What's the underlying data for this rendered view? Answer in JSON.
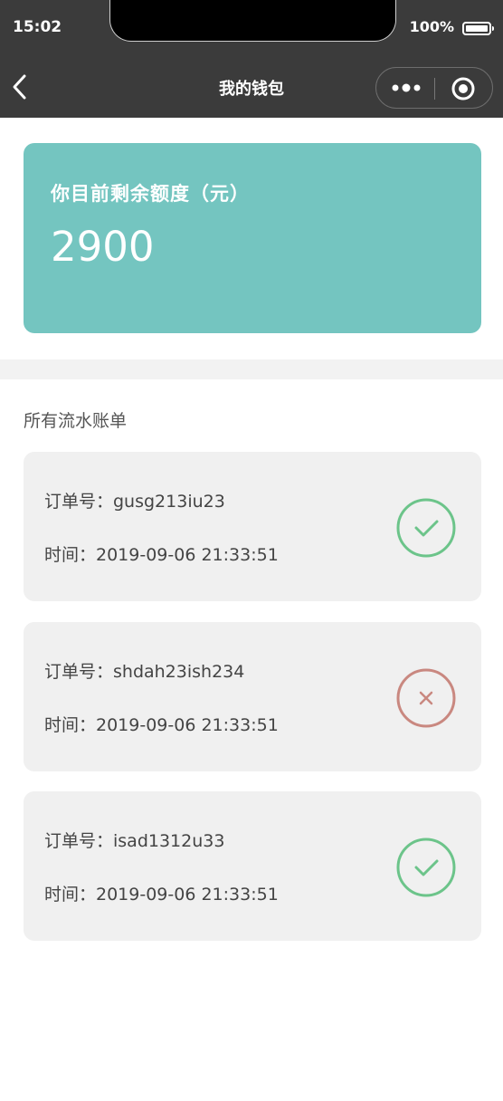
{
  "status_bar": {
    "time": "15:02",
    "battery": "100%"
  },
  "nav": {
    "title": "我的钱包"
  },
  "balance": {
    "label": "你目前剩余额度（元）",
    "value": "2900"
  },
  "transactions_section": {
    "title": "所有流水账单"
  },
  "transactions": [
    {
      "order": "订单号：gusg213iu23",
      "time": "时间：2019-09-06 21:33:51",
      "status": "success",
      "icon": "check-circle-icon"
    },
    {
      "order": "订单号：shdah23ish234",
      "time": "时间：2019-09-06 21:33:51",
      "status": "failed",
      "icon": "x-circle-icon"
    },
    {
      "order": "订单号：isad1312u33",
      "time": "时间：2019-09-06 21:33:51",
      "status": "success",
      "icon": "check-circle-icon"
    }
  ],
  "colors": {
    "nav_bg": "#3b3b3b",
    "card_accent": "#74c5c0",
    "success": "#6cc48a",
    "failed": "#c98880"
  }
}
